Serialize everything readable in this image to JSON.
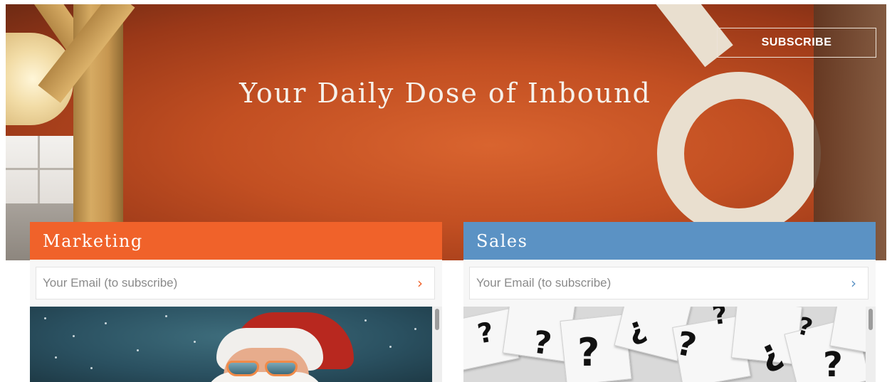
{
  "hero": {
    "title": "Your Daily Dose of Inbound",
    "subscribe_label": "SUBSCRIBE"
  },
  "cards": [
    {
      "title": "Marketing",
      "accent": "#f0622a",
      "email_placeholder": "Your Email (to subscribe)",
      "submit_icon": "chevron-right-icon"
    },
    {
      "title": "Sales",
      "accent": "#5b92c4",
      "email_placeholder": "Your Email (to subscribe)",
      "submit_icon": "chevron-right-icon"
    }
  ],
  "icons": {
    "chevron": "›"
  }
}
